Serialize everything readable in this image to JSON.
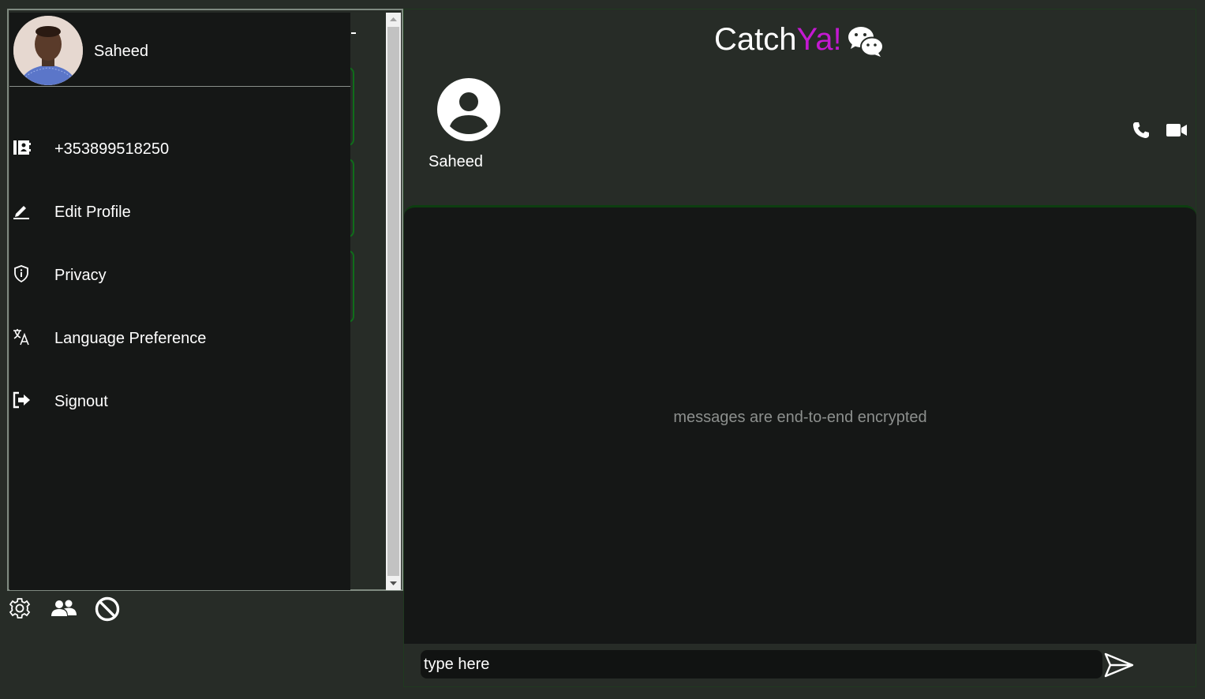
{
  "brand": {
    "part1": "Catch",
    "part2": "Ya!",
    "icon": "wechat-icon",
    "accent_color": "#c319d1"
  },
  "drawer": {
    "user_name": "Saheed",
    "items": [
      {
        "icon": "contact-card-icon",
        "label": "+353899518250"
      },
      {
        "icon": "pencil-icon",
        "label": "Edit Profile"
      },
      {
        "icon": "shield-icon",
        "label": "Privacy"
      },
      {
        "icon": "translate-icon",
        "label": "Language Preference"
      },
      {
        "icon": "sign-out-icon",
        "label": "Signout"
      }
    ]
  },
  "left_toolbar": [
    {
      "icon": "gear-icon"
    },
    {
      "icon": "users-icon"
    },
    {
      "icon": "block-icon"
    }
  ],
  "chat": {
    "contact_name": "Saheed",
    "encryption_note": "messages are end-to-end encrypted",
    "composer_placeholder": "type here"
  },
  "colors": {
    "background": "#272c27",
    "panel_dark": "#151716",
    "green_border": "#0f6d1a"
  }
}
